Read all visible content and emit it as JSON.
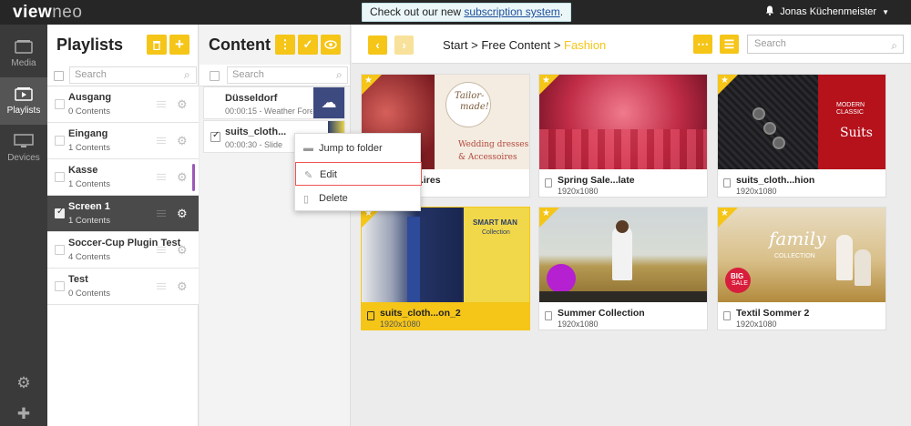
{
  "app": {
    "logo_a": "view",
    "logo_b": "neo"
  },
  "notice": {
    "prefix": "Check out our new ",
    "link": "subscription system",
    "suffix": "."
  },
  "user": {
    "name": "Jonas Küchenmeister"
  },
  "nav": [
    {
      "label": "Media",
      "icon": "media-icon"
    },
    {
      "label": "Playlists",
      "icon": "playlist-icon"
    },
    {
      "label": "Devices",
      "icon": "monitor-icon"
    }
  ],
  "playlists": {
    "title": "Playlists",
    "search_placeholder": "Search",
    "items": [
      {
        "name": "Ausgang",
        "count": "0 Contents"
      },
      {
        "name": "Eingang",
        "count": "1 Contents"
      },
      {
        "name": "Kasse",
        "count": "1 Contents"
      },
      {
        "name": "Screen 1",
        "count": "1 Contents"
      },
      {
        "name": "Soccer-Cup Plugin Test",
        "count": "4 Contents"
      },
      {
        "name": "Test",
        "count": "0 Contents"
      }
    ]
  },
  "content": {
    "title": "Content",
    "search_placeholder": "Search",
    "items": [
      {
        "name": "Düsseldorf",
        "sub": "00:00:15 - Weather Forecast"
      },
      {
        "name": "suits_cloth...",
        "sub": "00:00:30 - Slide"
      }
    ]
  },
  "context_menu": {
    "jump": "Jump to folder",
    "edit": "Edit",
    "delete": "Delete"
  },
  "main": {
    "breadcrumb": {
      "start": "Start",
      "sep": ">",
      "mid": "Free Content",
      "current": "Fashion"
    },
    "search_placeholder": "Search",
    "cards": [
      {
        "name": "suits_cl...ires",
        "res": "1920x1080",
        "img_lines": [
          "Tailor-",
          "made!",
          "Wedding dresses",
          "& Accessoires"
        ]
      },
      {
        "name": "Spring Sale...late",
        "res": "1920x1080"
      },
      {
        "name": "suits_cloth...hion",
        "res": "1920x1080",
        "img_lines": [
          "MODERN",
          "CLASSIC",
          "Suits"
        ]
      },
      {
        "name": "suits_cloth...on_2",
        "res": "1920x1080",
        "img_lines": [
          "SMART MAN",
          "Collection"
        ]
      },
      {
        "name": "Summer Collection",
        "res": "1920x1080"
      },
      {
        "name": "Textil Sommer 2",
        "res": "1920x1080",
        "img_lines": [
          "family",
          "COLLECTION",
          "BIG",
          "SALE"
        ]
      }
    ]
  },
  "colors": {
    "accent": "#f5c518",
    "dark": "#262626",
    "selected_row": "#4a4a4a",
    "purple": "#9b59b6"
  }
}
